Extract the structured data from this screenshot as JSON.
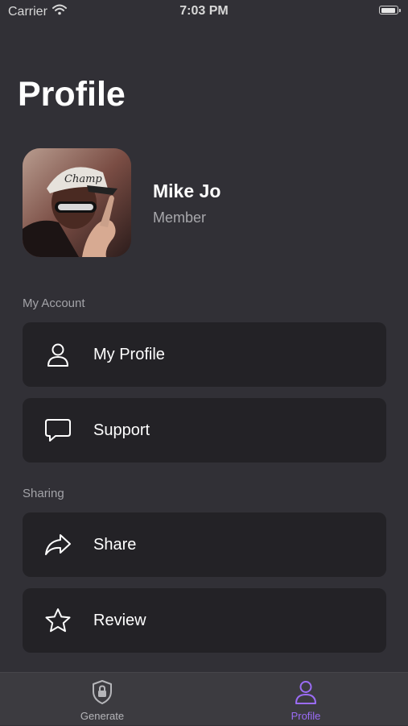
{
  "status_bar": {
    "carrier": "Carrier",
    "time": "7:03 PM"
  },
  "page": {
    "title": "Profile"
  },
  "profile": {
    "name": "Mike Jo",
    "role": "Member"
  },
  "sections": {
    "account_label": "My Account",
    "sharing_label": "Sharing"
  },
  "rows": {
    "my_profile": {
      "label": "My Profile",
      "icon": "person-icon"
    },
    "support": {
      "label": "Support",
      "icon": "chat-bubble-icon"
    },
    "share": {
      "label": "Share",
      "icon": "share-arrow-icon"
    },
    "review": {
      "label": "Review",
      "icon": "star-icon"
    }
  },
  "tabs": {
    "generate": {
      "label": "Generate",
      "icon": "lock-shield-icon",
      "color": "#b5b5b9"
    },
    "profile": {
      "label": "Profile",
      "icon": "person-icon",
      "color": "#9b6cf5",
      "selected": true
    }
  },
  "colors": {
    "background": "#313036",
    "row_background": "#232226",
    "tab_bar": "#3c3b40",
    "accent": "#9b6cf5"
  }
}
